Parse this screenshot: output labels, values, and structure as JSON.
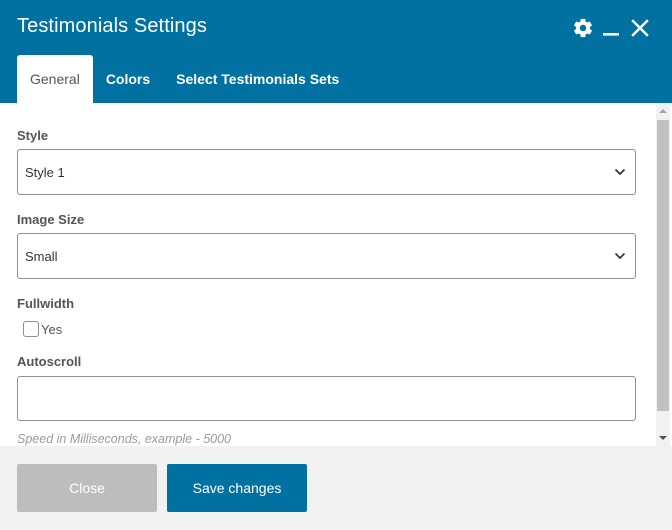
{
  "dialog": {
    "title": "Testimonials Settings",
    "icons": [
      "gear-icon",
      "minimize-icon",
      "close-icon"
    ]
  },
  "tabs": [
    {
      "label": "General",
      "active": true
    },
    {
      "label": "Colors",
      "active": false
    },
    {
      "label": "Select Testimonials Sets",
      "active": false
    }
  ],
  "form": {
    "style": {
      "label": "Style",
      "value": "Style 1"
    },
    "image_size": {
      "label": "Image Size",
      "value": "Small"
    },
    "fullwidth": {
      "label": "Fullwidth",
      "option_label": "Yes",
      "checked": false
    },
    "autoscroll": {
      "label": "Autoscroll",
      "value": "",
      "help": "Speed in Milliseconds, example - 5000"
    }
  },
  "footer": {
    "close_label": "Close",
    "save_label": "Save changes"
  },
  "colors": {
    "header": "#0071a1",
    "save_button": "#0071a1",
    "close_button": "#bdbdbd",
    "footer_bg": "#f1f1f1"
  }
}
